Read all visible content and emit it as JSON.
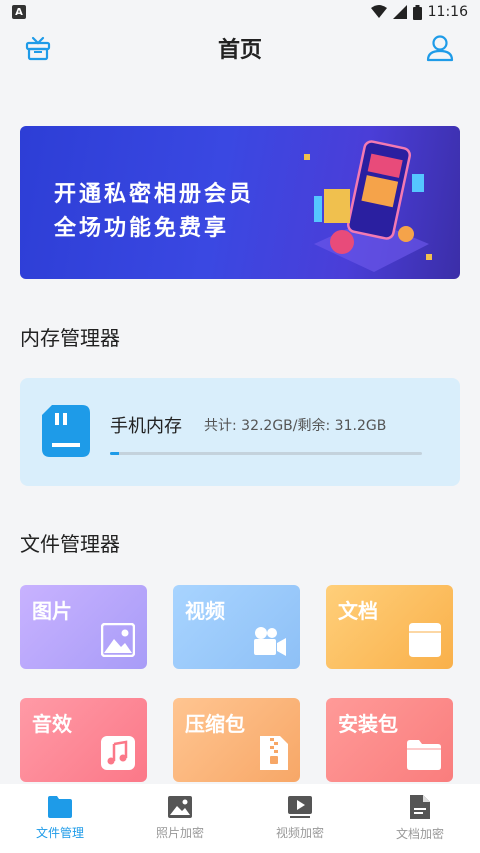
{
  "status_bar": {
    "badge": "A",
    "time": "11:16"
  },
  "header": {
    "title": "首页",
    "left_icon": "gift-icon",
    "right_icon": "user-icon"
  },
  "banner": {
    "line1": "开通私密相册会员",
    "line2": "全场功能免费享"
  },
  "memory_section": {
    "title": "内存管理器",
    "card": {
      "title": "手机内存",
      "total": "共计: 32.2GB/剩余: 31.2GB",
      "used_fraction": 0.03
    }
  },
  "file_section": {
    "title": "文件管理器",
    "tiles": [
      {
        "label": "图片",
        "icon": "image-icon"
      },
      {
        "label": "视频",
        "icon": "video-camera-icon"
      },
      {
        "label": "文档",
        "icon": "document-icon"
      },
      {
        "label": "音效",
        "icon": "music-icon"
      },
      {
        "label": "压缩包",
        "icon": "zip-icon"
      },
      {
        "label": "安装包",
        "icon": "folder-icon"
      }
    ]
  },
  "tab_bar": {
    "tabs": [
      {
        "label": "文件管理",
        "icon": "folder-icon",
        "active": true
      },
      {
        "label": "照片加密",
        "icon": "photo-icon",
        "active": false
      },
      {
        "label": "视频加密",
        "icon": "video-play-icon",
        "active": false
      },
      {
        "label": "文档加密",
        "icon": "file-icon",
        "active": false
      }
    ]
  },
  "colors": {
    "accent": "#1e9be8",
    "banner": "#3a48e2",
    "card_bg": "#d9eefb"
  }
}
